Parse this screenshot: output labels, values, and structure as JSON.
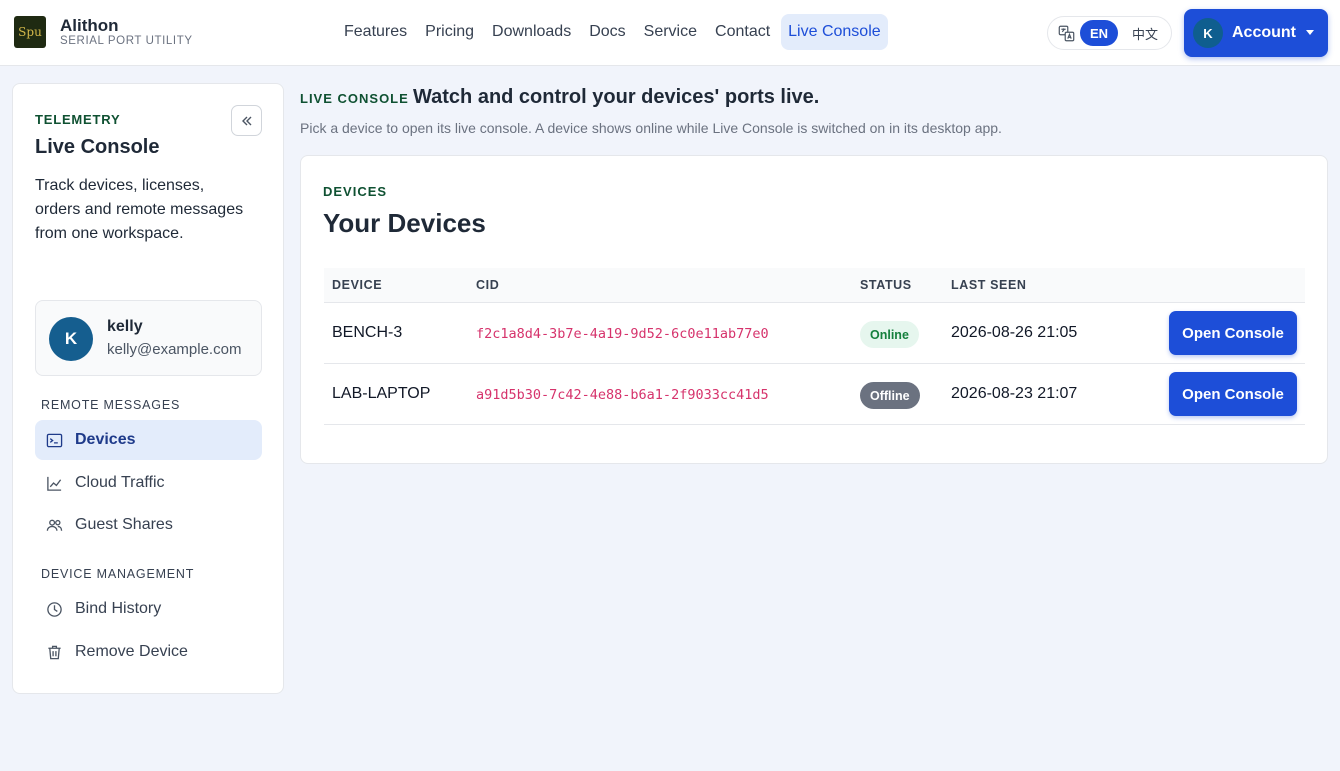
{
  "header": {
    "logo_text": "Spu",
    "brand_name": "Alithon",
    "brand_sub": "SERIAL PORT UTILITY",
    "nav": [
      "Features",
      "Pricing",
      "Downloads",
      "Docs",
      "Service",
      "Contact",
      "Live Console"
    ],
    "active_nav": "Live Console",
    "lang_en": "EN",
    "lang_zh": "中文",
    "account_initial": "K",
    "account_label": "Account"
  },
  "sidebar": {
    "eyebrow": "TELEMETRY",
    "title": "Live Console",
    "description": "Track devices, licenses, orders and remote messages from one workspace.",
    "user": {
      "initial": "K",
      "name": "kelly",
      "email": "kelly@example.com"
    },
    "sections": [
      {
        "label": "REMOTE MESSAGES",
        "items": [
          {
            "label": "Devices",
            "icon": "terminal-icon",
            "active": true
          },
          {
            "label": "Cloud Traffic",
            "icon": "line-chart-icon",
            "active": false
          },
          {
            "label": "Guest Shares",
            "icon": "users-icon",
            "active": false
          }
        ]
      },
      {
        "label": "DEVICE MANAGEMENT",
        "items": [
          {
            "label": "Bind History",
            "icon": "clock-icon",
            "active": false
          },
          {
            "label": "Remove Device",
            "icon": "trash-icon",
            "active": false
          }
        ]
      }
    ]
  },
  "main": {
    "eyebrow": "LIVE CONSOLE",
    "headline": "Watch and control your devices' ports live.",
    "subtitle": "Pick a device to open its live console. A device shows online while Live Console is switched on in its desktop app.",
    "card": {
      "eyebrow": "DEVICES",
      "title": "Your Devices",
      "columns": [
        "DEVICE",
        "CID",
        "STATUS",
        "LAST SEEN"
      ],
      "rows": [
        {
          "device": "BENCH-3",
          "cid": "f2c1a8d4-3b7e-4a19-9d52-6c0e11ab77e0",
          "status": "Online",
          "last_seen": "2026-08-26 21:05",
          "action": "Open Console"
        },
        {
          "device": "LAB-LAPTOP",
          "cid": "a91d5b30-7c42-4e88-b6a1-2f9033cc41d5",
          "status": "Offline",
          "last_seen": "2026-08-23 21:07",
          "action": "Open Console"
        }
      ]
    }
  },
  "colors": {
    "primary": "#1d4ed8",
    "accent_green": "#0f5132",
    "online": "#15803d",
    "offline": "#6b7280",
    "cid": "#d6336c"
  }
}
